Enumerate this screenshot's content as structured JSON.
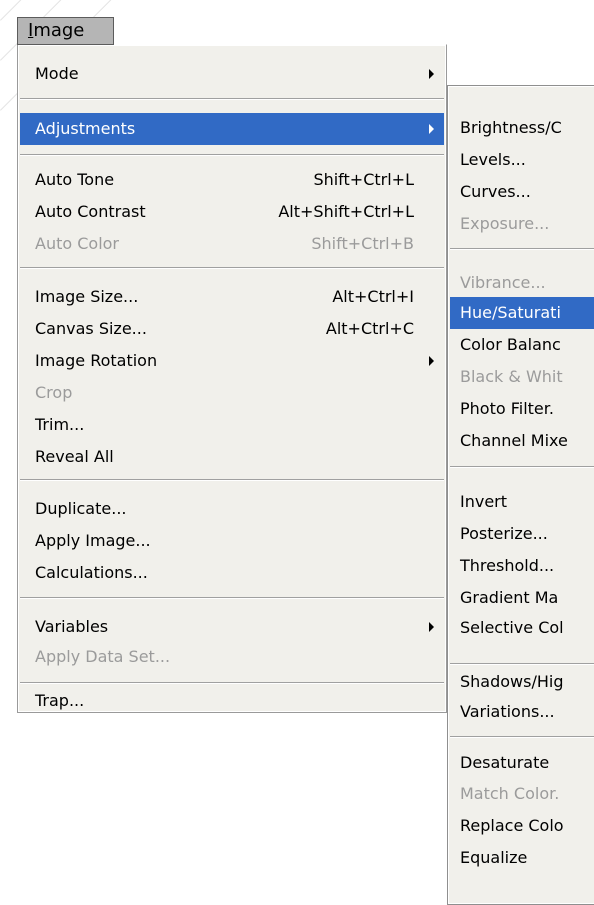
{
  "menubar": {
    "image_label": "Image"
  },
  "main_menu": {
    "mode": "Mode",
    "adjustments": "Adjustments",
    "auto_tone": {
      "label": "Auto Tone",
      "shortcut": "Shift+Ctrl+L"
    },
    "auto_contrast": {
      "label": "Auto Contrast",
      "shortcut": "Alt+Shift+Ctrl+L"
    },
    "auto_color": {
      "label": "Auto Color",
      "shortcut": "Shift+Ctrl+B"
    },
    "image_size": {
      "label": "Image Size...",
      "shortcut": "Alt+Ctrl+I"
    },
    "canvas_size": {
      "label": "Canvas Size...",
      "shortcut": "Alt+Ctrl+C"
    },
    "image_rotation": "Image Rotation",
    "crop": "Crop",
    "trim": "Trim...",
    "reveal_all": "Reveal All",
    "duplicate": "Duplicate...",
    "apply_image": "Apply Image...",
    "calculations": "Calculations...",
    "variables": "Variables",
    "apply_data_set": "Apply Data Set...",
    "trap": "Trap..."
  },
  "sub_menu": {
    "brightness": "Brightness/C",
    "levels": "Levels...",
    "curves": "Curves...",
    "exposure": "Exposure...",
    "vibrance": "Vibrance...",
    "hue_saturation": "Hue/Saturati",
    "color_balance": "Color Balanc",
    "black_white": "Black & Whit",
    "photo_filter": "Photo Filter.",
    "channel_mixer": "Channel Mixe",
    "invert": "Invert",
    "posterize": "Posterize...",
    "threshold": "Threshold...",
    "gradient_map": "Gradient Ma",
    "selective_color": "Selective Col",
    "shadows_highlights": "Shadows/Hig",
    "variations": "Variations...",
    "desaturate": "Desaturate",
    "match_color": "Match Color.",
    "replace_color": "Replace Colo",
    "equalize": "Equalize"
  },
  "colors": {
    "selection": "#316ac5",
    "menu_bg": "#f1f0eb",
    "disabled_text": "#9b9b9b"
  }
}
